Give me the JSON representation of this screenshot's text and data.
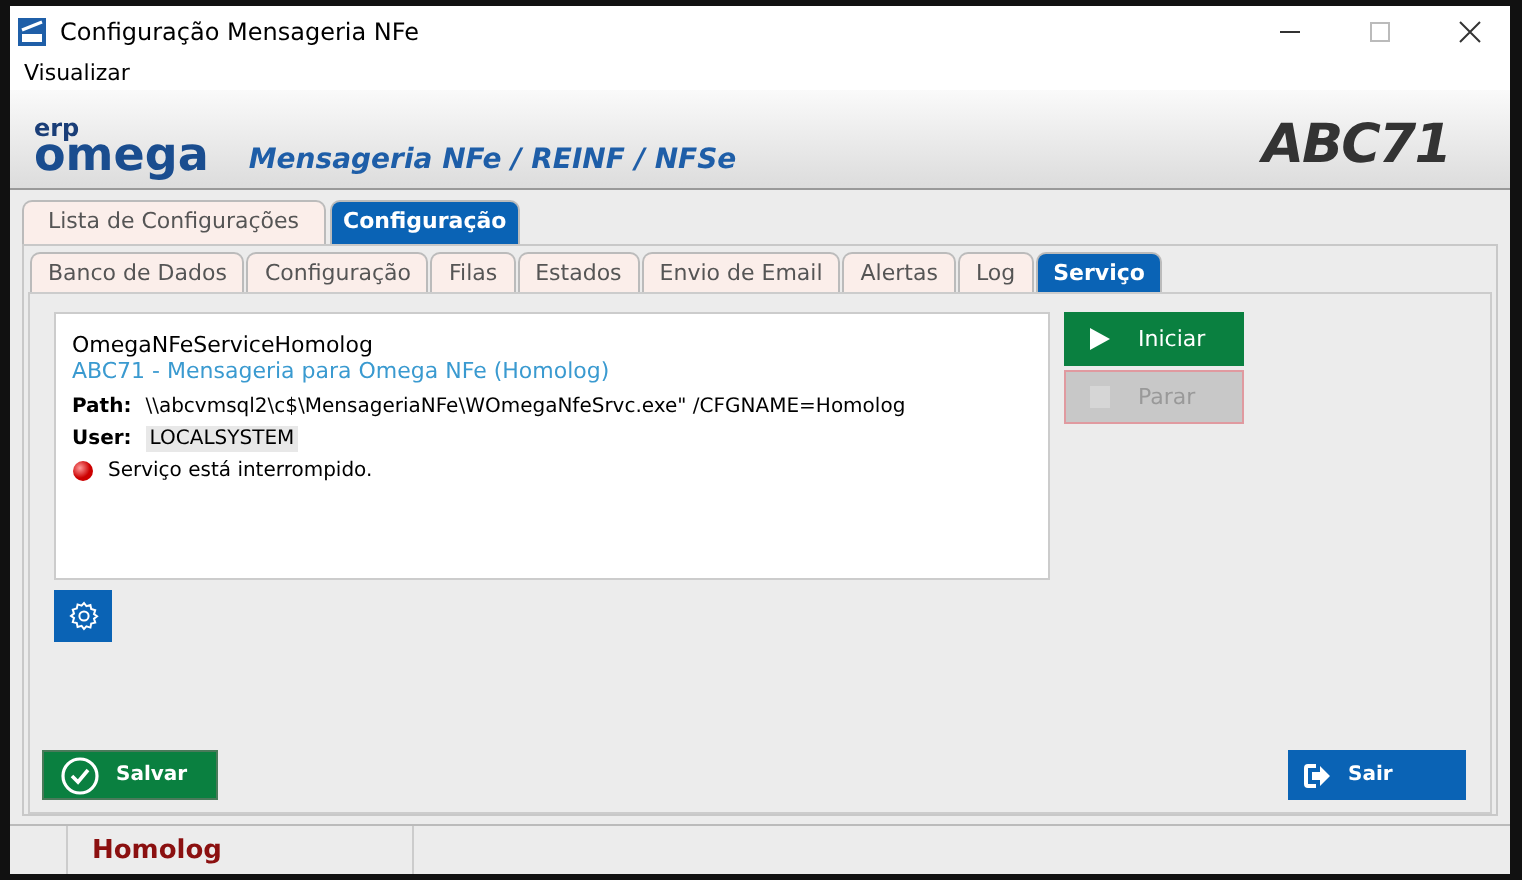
{
  "window": {
    "title": "Configuração Mensageria NFe"
  },
  "menu": [
    "Visualizar"
  ],
  "header": {
    "logo_small": "erp",
    "logo": "omega",
    "subtitle": "Mensageria NFe / REINF / NFSe",
    "brand": "ABC71"
  },
  "tabs": [
    {
      "label": "Lista de Configurações",
      "selected": false
    },
    {
      "label": "Configuração",
      "selected": true
    }
  ],
  "subtabs": [
    {
      "label": "Banco de Dados",
      "selected": false
    },
    {
      "label": "Configuração",
      "selected": false
    },
    {
      "label": "Filas",
      "selected": false
    },
    {
      "label": "Estados",
      "selected": false
    },
    {
      "label": "Envio de Email",
      "selected": false
    },
    {
      "label": "Alertas",
      "selected": false
    },
    {
      "label": "Log",
      "selected": false
    },
    {
      "label": "Serviço",
      "selected": true
    }
  ],
  "service": {
    "name": "OmegaNFeServiceHomolog",
    "description": "ABC71 - Mensageria para Omega NFe (Homolog)",
    "path_label": "Path:",
    "path": "\\\\abcvmsql2\\c$\\MensageriaNFe\\WOmegaNfeSrvc.exe\" /CFGNAME=Homolog",
    "user_label": "User:",
    "user": "LOCALSYSTEM",
    "status": "Serviço está interrompido.",
    "running": false
  },
  "service_buttons": [
    {
      "label": "Iniciar",
      "disabled": false
    },
    {
      "label": "Parar",
      "disabled": true
    }
  ],
  "buttons": [
    {
      "label": "Salvar",
      "kind": "save"
    },
    {
      "label": "Sair",
      "kind": "exit"
    }
  ],
  "status_bar": [
    "Homolog"
  ]
}
